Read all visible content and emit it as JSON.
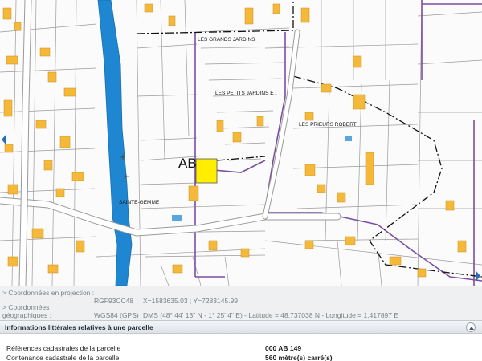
{
  "map": {
    "section_label": "AB",
    "place_labels": {
      "grands_jardins": "LES GRANDS JARDINS",
      "petits_jardins": "LES PETITS JARDINS E",
      "prieurs_robert": "LES PRIEURS ROBERT",
      "sainte_gemme": "SAINTE-GEMME"
    },
    "colors": {
      "river": "#1f86d1",
      "building": "#f5b93a",
      "selected_parcel": "#ffee00",
      "commune_boundary": "#7a4fa0",
      "parcel_line": "#8c8c8c",
      "section_boundary": "#000000"
    }
  },
  "coordinates": {
    "projection_label": "> Coordonnées en projection :",
    "projection_system": "RGF93CC48",
    "projection_value": "X=1583635.03 ; Y=7283145.99",
    "geographic_label_1": "> Coordonnées",
    "geographic_label_2": "géographiques :",
    "geographic_system": "WGS84 (GPS)",
    "geographic_value": "DMS (48° 44' 13\" N - 1° 25' 4\" E) - Latitude = 48.737038 N - Longitude = 1.417897 E"
  },
  "info": {
    "title": "Informations littérales relatives à une parcelle",
    "rows": [
      {
        "key": "Références cadastrales de la parcelle",
        "value": "000 AB 149"
      },
      {
        "key": "Contenance cadastrale de la parcelle",
        "value": "560 mètre(s) carré(s)"
      }
    ]
  }
}
